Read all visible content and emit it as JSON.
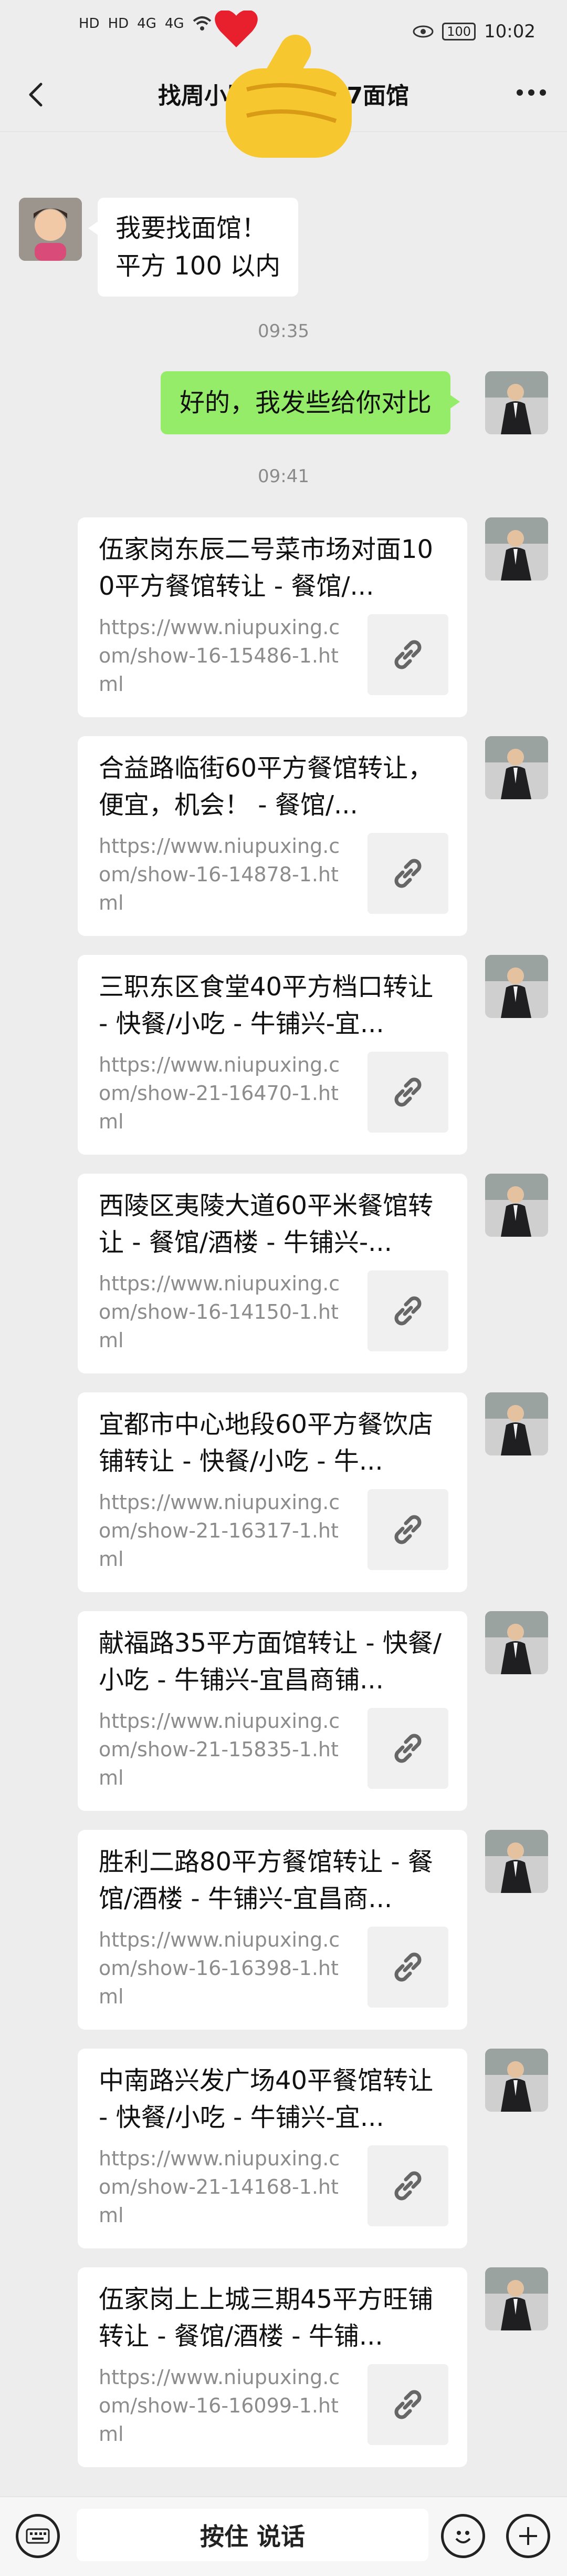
{
  "status_bar": {
    "time": "10:02",
    "battery": "100",
    "signal_labels": [
      "HD",
      "HD",
      "4G",
      "4G"
    ]
  },
  "header": {
    "title": "找周小胖1538527面馆"
  },
  "messages": {
    "incoming_1": {
      "line1": "我要找面馆！",
      "line2": "平方 100 以内"
    },
    "time_1": "09:35",
    "outgoing_1": "好的，我发些给你对比",
    "time_2": "09:41"
  },
  "links": [
    {
      "title": "伍家岗东辰二号菜市场对面100平方餐馆转让 - 餐馆/...",
      "url": "https://www.niupuxing.com/show-16-15486-1.html"
    },
    {
      "title": "合益路临街60平方餐馆转让，便宜，机会！ - 餐馆/...",
      "url": "https://www.niupuxing.com/show-16-14878-1.html"
    },
    {
      "title": "三职东区食堂40平方档口转让 - 快餐/小吃 - 牛铺兴-宜...",
      "url": "https://www.niupuxing.com/show-21-16470-1.html"
    },
    {
      "title": "西陵区夷陵大道60平米餐馆转让 - 餐馆/酒楼 - 牛铺兴-...",
      "url": "https://www.niupuxing.com/show-16-14150-1.html"
    },
    {
      "title": "宜都市中心地段60平方餐饮店铺转让 - 快餐/小吃 - 牛...",
      "url": "https://www.niupuxing.com/show-21-16317-1.html"
    },
    {
      "title": "献福路35平方面馆转让 - 快餐/小吃 - 牛铺兴-宜昌商铺...",
      "url": "https://www.niupuxing.com/show-21-15835-1.html"
    },
    {
      "title": "胜利二路80平方餐馆转让 - 餐馆/酒楼 - 牛铺兴-宜昌商...",
      "url": "https://www.niupuxing.com/show-16-16398-1.html"
    },
    {
      "title": "中南路兴发广场40平餐馆转让 - 快餐/小吃 - 牛铺兴-宜...",
      "url": "https://www.niupuxing.com/show-21-14168-1.html"
    },
    {
      "title": "伍家岗上上城三期45平方旺铺转让 - 餐馆/酒楼 - 牛铺...",
      "url": "https://www.niupuxing.com/show-16-16099-1.html"
    }
  ],
  "input_bar": {
    "hold_to_talk": "按住 说话"
  },
  "colors": {
    "background": "#ededed",
    "outgoing_bubble": "#95ec69",
    "card": "#ffffff"
  },
  "icons": [
    "back-icon",
    "more-icon",
    "link-icon",
    "keyboard-icon",
    "emoji-icon",
    "plus-icon",
    "finger-heart-emoji"
  ]
}
